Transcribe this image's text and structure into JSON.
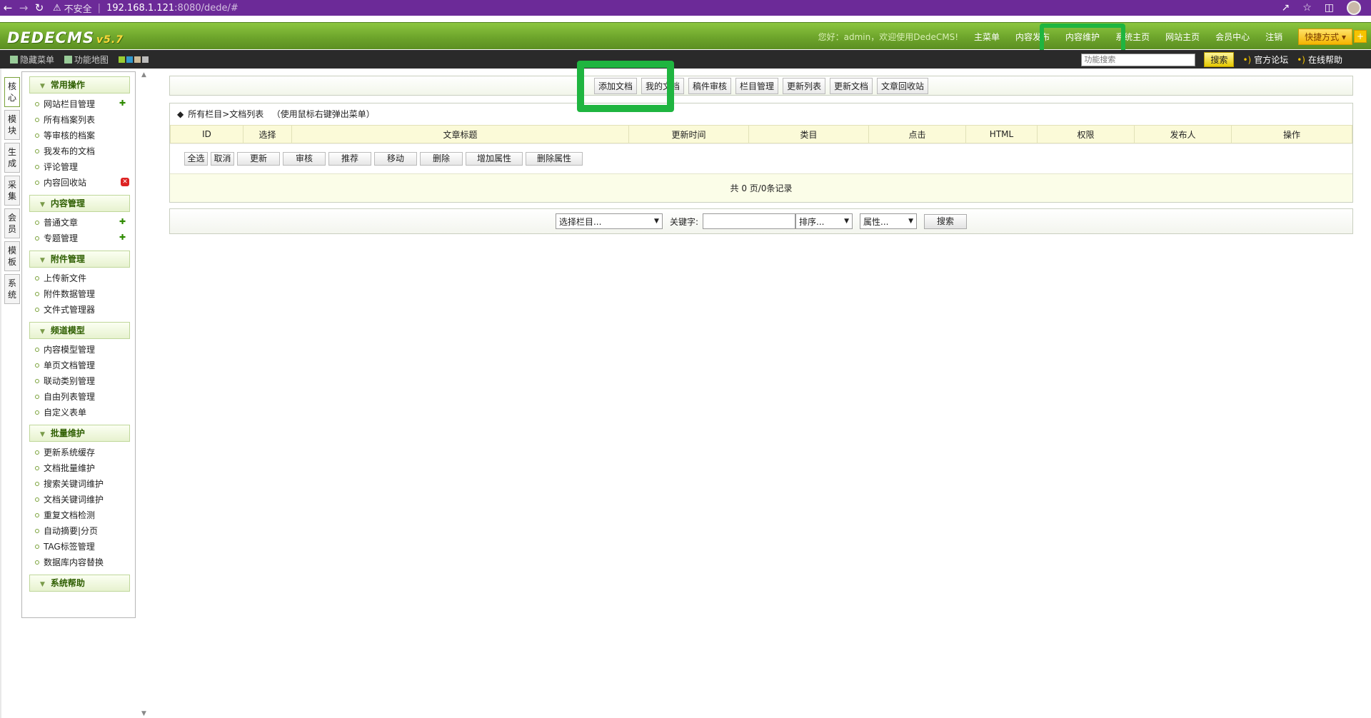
{
  "browser": {
    "insecure_label": "不安全",
    "url_host": "192.168.1.121",
    "url_rest": ":8080/dede/#"
  },
  "header": {
    "logo_text": "DEDECMS",
    "logo_version": "v5.7",
    "welcome": "您好：admin，欢迎使用DedeCMS!",
    "nav": [
      "主菜单",
      "内容发布",
      "内容维护",
      "系统主页",
      "网站主页",
      "会员中心",
      "注销"
    ],
    "quick_label": "快捷方式",
    "plus": "+"
  },
  "subbar": {
    "hide_menu": "隐藏菜单",
    "site_map": "功能地图",
    "search_placeholder": "功能搜索",
    "search_button": "搜索",
    "forum": "官方论坛",
    "help": "在线帮助"
  },
  "vtabs": [
    "核心",
    "模块",
    "生成",
    "采集",
    "会员",
    "模板",
    "系统"
  ],
  "sidebar": {
    "sections": [
      {
        "title": "常用操作",
        "items": [
          "网站栏目管理",
          "所有档案列表",
          "等审核的档案",
          "我发布的文档",
          "评论管理",
          "内容回收站"
        ]
      },
      {
        "title": "内容管理",
        "items": [
          "普通文章",
          "专题管理"
        ]
      },
      {
        "title": "附件管理",
        "items": [
          "上传新文件",
          "附件数据管理",
          "文件式管理器"
        ]
      },
      {
        "title": "频道模型",
        "items": [
          "内容模型管理",
          "单页文档管理",
          "联动类别管理",
          "自由列表管理",
          "自定义表单"
        ]
      },
      {
        "title": "批量维护",
        "items": [
          "更新系统缓存",
          "文档批量维护",
          "搜索关键词维护",
          "文档关键词维护",
          "重复文档检测",
          "自动摘要|分页",
          "TAG标签管理",
          "数据库内容替换"
        ]
      },
      {
        "title": "系统帮助",
        "items": []
      }
    ]
  },
  "toolbar": [
    "添加文档",
    "我的文档",
    "稿件审核",
    "栏目管理",
    "更新列表",
    "更新文档",
    "文章回收站"
  ],
  "list": {
    "breadcrumb": "所有栏目>文档列表",
    "hint": "（使用鼠标右键弹出菜单）",
    "columns": [
      "ID",
      "选择",
      "文章标题",
      "更新时间",
      "类目",
      "点击",
      "HTML",
      "权限",
      "发布人",
      "操作"
    ],
    "actions": [
      "全选",
      "取消",
      "更新",
      "审核",
      "推荐",
      "移动",
      "删除",
      "增加属性",
      "删除属性"
    ],
    "pager": "共 0 页/0条记录"
  },
  "searchbar": {
    "channel_select": "选择栏目...",
    "keyword_label": "关键字:",
    "order_select": "排序...",
    "attr_select": "属性...",
    "button": "搜索"
  }
}
